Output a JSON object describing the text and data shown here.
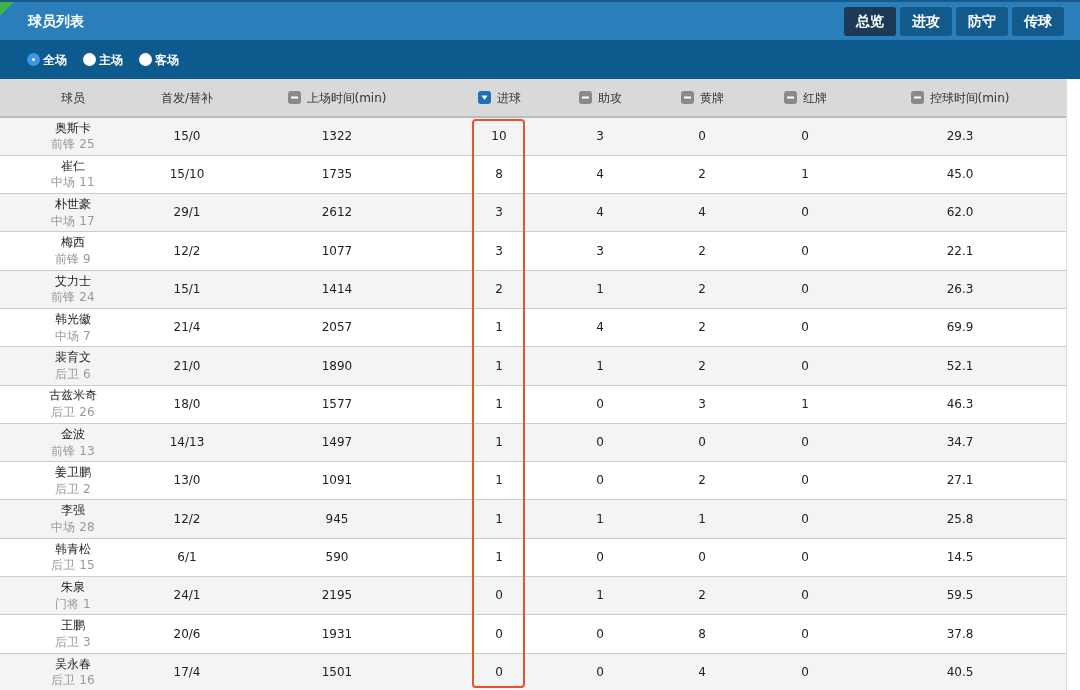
{
  "title": "球员列表",
  "tabs": [
    {
      "label": "总览",
      "selected": true
    },
    {
      "label": "进攻",
      "selected": false
    },
    {
      "label": "防守",
      "selected": false
    },
    {
      "label": "传球",
      "selected": false
    }
  ],
  "filters": [
    {
      "label": "全场",
      "selected": true
    },
    {
      "label": "主场",
      "selected": false
    },
    {
      "label": "客场",
      "selected": false
    }
  ],
  "table": {
    "columns": [
      {
        "label": "球员"
      },
      {
        "label": "首发/替补"
      },
      {
        "label": "上场时间(min)",
        "sorted": false
      },
      {
        "label": "进球",
        "sorted": true,
        "highlighted": true
      },
      {
        "label": "助攻",
        "sorted": false
      },
      {
        "label": "黄牌",
        "sorted": false
      },
      {
        "label": "红牌",
        "sorted": false
      },
      {
        "label": "控球时间(min)",
        "sorted": false
      }
    ],
    "rows": [
      {
        "cells": [
          {
            "name": "奥斯卡",
            "position": "前锋 25"
          },
          "15/0",
          "1322",
          "10",
          "3",
          "0",
          "0",
          "29.3"
        ]
      },
      {
        "cells": [
          {
            "name": "崔仁",
            "position": "中场 11"
          },
          "15/10",
          "1735",
          "8",
          "4",
          "2",
          "1",
          "45.0"
        ]
      },
      {
        "cells": [
          {
            "name": "朴世豪",
            "position": "中场 17"
          },
          "29/1",
          "2612",
          "3",
          "4",
          "4",
          "0",
          "62.0"
        ]
      },
      {
        "cells": [
          {
            "name": "梅西",
            "position": "前锋 9"
          },
          "12/2",
          "1077",
          "3",
          "3",
          "2",
          "0",
          "22.1"
        ]
      },
      {
        "cells": [
          {
            "name": "艾力士",
            "position": "前锋 24"
          },
          "15/1",
          "1414",
          "2",
          "1",
          "2",
          "0",
          "26.3"
        ]
      },
      {
        "cells": [
          {
            "name": "韩光徽",
            "position": "中场 7"
          },
          "21/4",
          "2057",
          "1",
          "4",
          "2",
          "0",
          "69.9"
        ]
      },
      {
        "cells": [
          {
            "name": "裴育文",
            "position": "后卫 6"
          },
          "21/0",
          "1890",
          "1",
          "1",
          "2",
          "0",
          "52.1"
        ]
      },
      {
        "cells": [
          {
            "name": "古兹米奇",
            "position": "后卫 26"
          },
          "18/0",
          "1577",
          "1",
          "0",
          "3",
          "1",
          "46.3"
        ]
      },
      {
        "cells": [
          {
            "name": "金波",
            "position": "前锋 13"
          },
          "14/13",
          "1497",
          "1",
          "0",
          "0",
          "0",
          "34.7"
        ]
      },
      {
        "cells": [
          {
            "name": "姜卫鹏",
            "position": "后卫 2"
          },
          "13/0",
          "1091",
          "1",
          "0",
          "2",
          "0",
          "27.1"
        ]
      },
      {
        "cells": [
          {
            "name": "李强",
            "position": "中场 28"
          },
          "12/2",
          "945",
          "1",
          "1",
          "1",
          "0",
          "25.8"
        ]
      },
      {
        "cells": [
          {
            "name": "韩青松",
            "position": "后卫 15"
          },
          "6/1",
          "590",
          "1",
          "0",
          "0",
          "0",
          "14.5"
        ]
      },
      {
        "cells": [
          {
            "name": "朱泉",
            "position": "门将 1"
          },
          "24/1",
          "2195",
          "0",
          "1",
          "2",
          "0",
          "59.5"
        ]
      },
      {
        "cells": [
          {
            "name": "王鹏",
            "position": "后卫 3"
          },
          "20/6",
          "1931",
          "0",
          "0",
          "8",
          "0",
          "37.8"
        ]
      },
      {
        "cells": [
          {
            "name": "吴永春",
            "position": "后卫 16"
          },
          "17/4",
          "1501",
          "0",
          "0",
          "4",
          "0",
          "40.5"
        ]
      }
    ]
  }
}
